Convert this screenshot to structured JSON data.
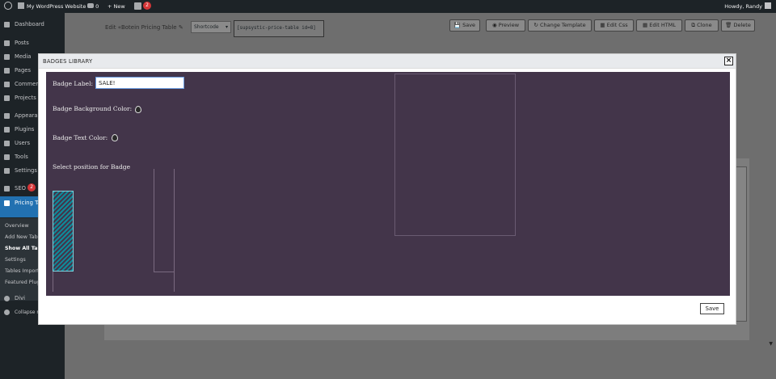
{
  "admin_bar": {
    "site_name": "My WordPress Website",
    "comments_count": "0",
    "new_label": "New",
    "yoast_count": "2",
    "greeting": "Howdy, Randy"
  },
  "menu": {
    "items": [
      {
        "label": "Dashboard"
      },
      {
        "label": "Posts"
      },
      {
        "label": "Media"
      },
      {
        "label": "Pages"
      },
      {
        "label": "Comments"
      },
      {
        "label": "Projects"
      },
      {
        "label": "Appearance"
      },
      {
        "label": "Plugins"
      },
      {
        "label": "Users"
      },
      {
        "label": "Tools"
      },
      {
        "label": "Settings"
      },
      {
        "label": "SEO",
        "count": "2"
      },
      {
        "label": "Pricing Tables by Supsystic"
      }
    ],
    "submenu": [
      {
        "label": "Overview"
      },
      {
        "label": "Add New Table"
      },
      {
        "label": "Show All Tables"
      },
      {
        "label": "Settings"
      },
      {
        "label": "Tables Import"
      },
      {
        "label": "Featured Plugins"
      }
    ],
    "divi_label": "Divi",
    "collapse_label": "Collapse menu"
  },
  "toolbar": {
    "edit_text": "Edit «Botein Pricing Table",
    "shortcode_select": "Shortcode",
    "shortcode_value": "[supsystic-price-table id=8]",
    "buttons": [
      {
        "label": "Save"
      },
      {
        "label": "Preview"
      },
      {
        "label": "Change Template"
      },
      {
        "label": "Edit Css"
      },
      {
        "label": "Edit HTML"
      },
      {
        "label": "Clone"
      },
      {
        "label": "Delete"
      }
    ]
  },
  "modal": {
    "title": "BADGES LIBRARY",
    "close_icon": "×",
    "badge_label_text": "Badge Label:",
    "badge_label_value": "SALE!",
    "badge_bg_text": "Badge Background Color:",
    "badge_text_color_text": "Badge Text Color:",
    "position_text": "Select position for Badge",
    "save_label": "Save",
    "panel_color": "#43354a"
  },
  "colors": {
    "admin_bar": "#1d2327",
    "current_menu": "#2271b1",
    "accent_green": "#3c9b2f",
    "selected_position": "#0f8a9a"
  }
}
